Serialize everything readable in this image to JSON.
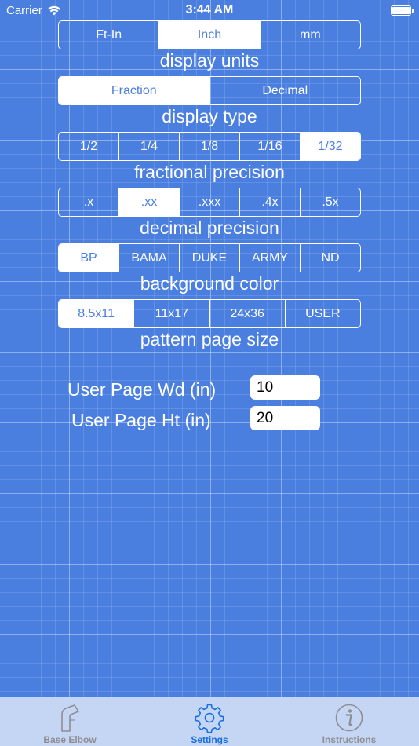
{
  "status_bar": {
    "carrier": "Carrier",
    "time": "3:44 AM"
  },
  "controls": [
    {
      "caption": "display units",
      "options": [
        "Ft-In",
        "Inch",
        "mm"
      ],
      "selected": 1
    },
    {
      "caption": "display type",
      "options": [
        "Fraction",
        "Decimal"
      ],
      "selected": 0
    },
    {
      "caption": "fractional precision",
      "options": [
        "1/2",
        "1/4",
        "1/8",
        "1/16",
        "1/32"
      ],
      "selected": 4
    },
    {
      "caption": "decimal precision",
      "options": [
        ".x",
        ".xx",
        ".xxx",
        ".4x",
        ".5x"
      ],
      "selected": 1
    },
    {
      "caption": "background color",
      "options": [
        "BP",
        "BAMA",
        "DUKE",
        "ARMY",
        "ND"
      ],
      "selected": 0
    },
    {
      "caption": "pattern page size",
      "options": [
        "8.5x11",
        "11x17",
        "24x36",
        "USER"
      ],
      "selected": 0
    }
  ],
  "user_page": {
    "width_label": "User Page Wd (in)",
    "width_value": "10",
    "height_label": "User Page Ht (in)",
    "height_value": "20"
  },
  "tab_bar": {
    "tabs": [
      {
        "label": "Base Elbow",
        "icon": "elbow-icon",
        "active": false
      },
      {
        "label": "Settings",
        "icon": "gear-icon",
        "active": true
      },
      {
        "label": "Instructions",
        "icon": "info-icon",
        "active": false
      }
    ]
  },
  "colors": {
    "background": "#4a7fe0",
    "tab_bar": "#c5d6f4",
    "active_tab": "#1a6fe0",
    "inactive_tab": "#8e8e93"
  }
}
